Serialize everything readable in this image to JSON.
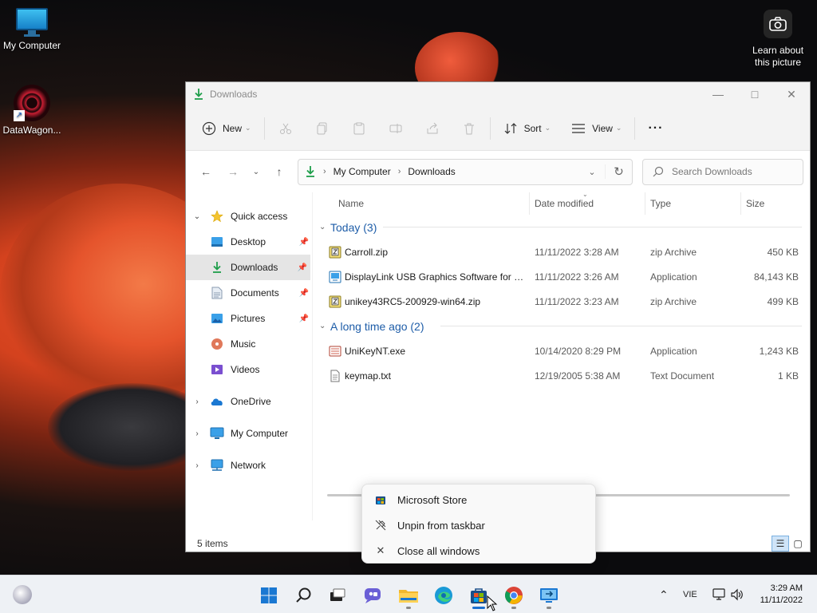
{
  "desktop": {
    "icons": [
      {
        "label": "My Computer",
        "icon": "computer-icon"
      },
      {
        "label": "DataWagon...",
        "icon": "datawagon-shortcut-icon"
      }
    ],
    "spotlight": {
      "line1": "Learn about",
      "line2": "this picture",
      "icon": "camera-icon"
    }
  },
  "window": {
    "title": "Downloads",
    "toolbar": {
      "new_label": "New",
      "sort_label": "Sort",
      "view_label": "View",
      "more_label": "···"
    },
    "address": {
      "crumbs": [
        "My Computer",
        "Downloads"
      ]
    },
    "search": {
      "placeholder": "Search Downloads"
    },
    "nav": {
      "quick_access": "Quick access",
      "items": [
        {
          "label": "Desktop",
          "pinned": true
        },
        {
          "label": "Downloads",
          "pinned": true,
          "selected": true
        },
        {
          "label": "Documents",
          "pinned": true
        },
        {
          "label": "Pictures",
          "pinned": true
        },
        {
          "label": "Music",
          "pinned": false
        },
        {
          "label": "Videos",
          "pinned": false
        }
      ],
      "onedrive": "OneDrive",
      "my_computer": "My Computer",
      "network": "Network"
    },
    "columns": {
      "name": "Name",
      "date": "Date modified",
      "type": "Type",
      "size": "Size"
    },
    "groups": [
      {
        "title": "Today (3)",
        "files": [
          {
            "name": "Carroll.zip",
            "date": "11/11/2022 3:28 AM",
            "type": "zip Archive",
            "size": "450 KB",
            "icon": "zip-icon"
          },
          {
            "name": "DisplayLink USB Graphics Software for Wi...",
            "date": "11/11/2022 3:26 AM",
            "type": "Application",
            "size": "84,143 KB",
            "icon": "installer-icon"
          },
          {
            "name": "unikey43RC5-200929-win64.zip",
            "date": "11/11/2022 3:23 AM",
            "type": "zip Archive",
            "size": "499 KB",
            "icon": "zip-icon"
          }
        ]
      },
      {
        "title": "A long time ago (2)",
        "files": [
          {
            "name": "UniKeyNT.exe",
            "date": "10/14/2020 8:29 PM",
            "type": "Application",
            "size": "1,243 KB",
            "icon": "exe-icon"
          },
          {
            "name": "keymap.txt",
            "date": "12/19/2005 5:38 AM",
            "type": "Text Document",
            "size": "1 KB",
            "icon": "text-file-icon"
          }
        ]
      }
    ],
    "status": "5 items"
  },
  "context_menu": {
    "items": [
      {
        "label": "Microsoft Store",
        "icon": "store-icon"
      },
      {
        "label": "Unpin from taskbar",
        "icon": "unpin-icon"
      },
      {
        "label": "Close all windows",
        "icon": "close-icon"
      }
    ]
  },
  "taskbar": {
    "language": "VIE",
    "time": "3:29 AM",
    "date": "11/11/2022"
  },
  "colors": {
    "accent": "#1a6fd0",
    "group_header": "#1e5da8",
    "download_green": "#1e9e4a"
  }
}
